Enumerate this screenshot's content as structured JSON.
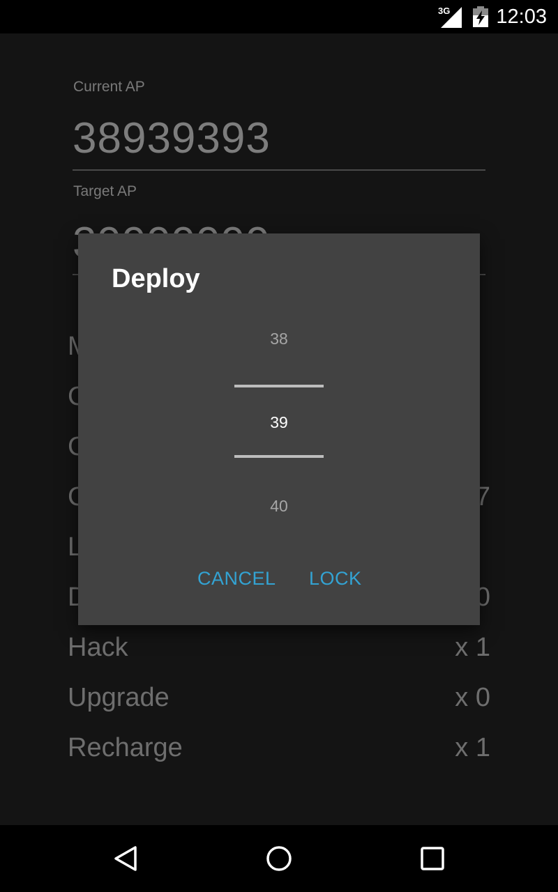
{
  "status_bar": {
    "network_type": "3G",
    "time": "12:03",
    "icons": [
      "signal-icon",
      "battery-charging-icon"
    ]
  },
  "form": {
    "current_ap_label": "Current AP",
    "current_ap_value": "38939393",
    "target_ap_label": "Target AP",
    "target_ap_value_partial": "39999999"
  },
  "list": {
    "rows": [
      {
        "label": "M",
        "value": ""
      },
      {
        "label": "C",
        "value": ""
      },
      {
        "label": "C",
        "value": ""
      },
      {
        "label": "C",
        "value": "7"
      },
      {
        "label": "L",
        "value": ""
      },
      {
        "label": "D",
        "value": "0"
      },
      {
        "label": "Hack",
        "value": "x 1"
      },
      {
        "label": "Upgrade",
        "value": "x 0"
      },
      {
        "label": "Recharge",
        "value": "x 1"
      }
    ]
  },
  "dialog": {
    "title": "Deploy",
    "picker": {
      "previous": "38",
      "current": "39",
      "next": "40"
    },
    "cancel_label": "CANCEL",
    "ok_label": "LOCK",
    "accent_color": "#33a3d3"
  },
  "nav_bar": {
    "icons": [
      "back-icon",
      "home-icon",
      "recents-icon"
    ]
  }
}
